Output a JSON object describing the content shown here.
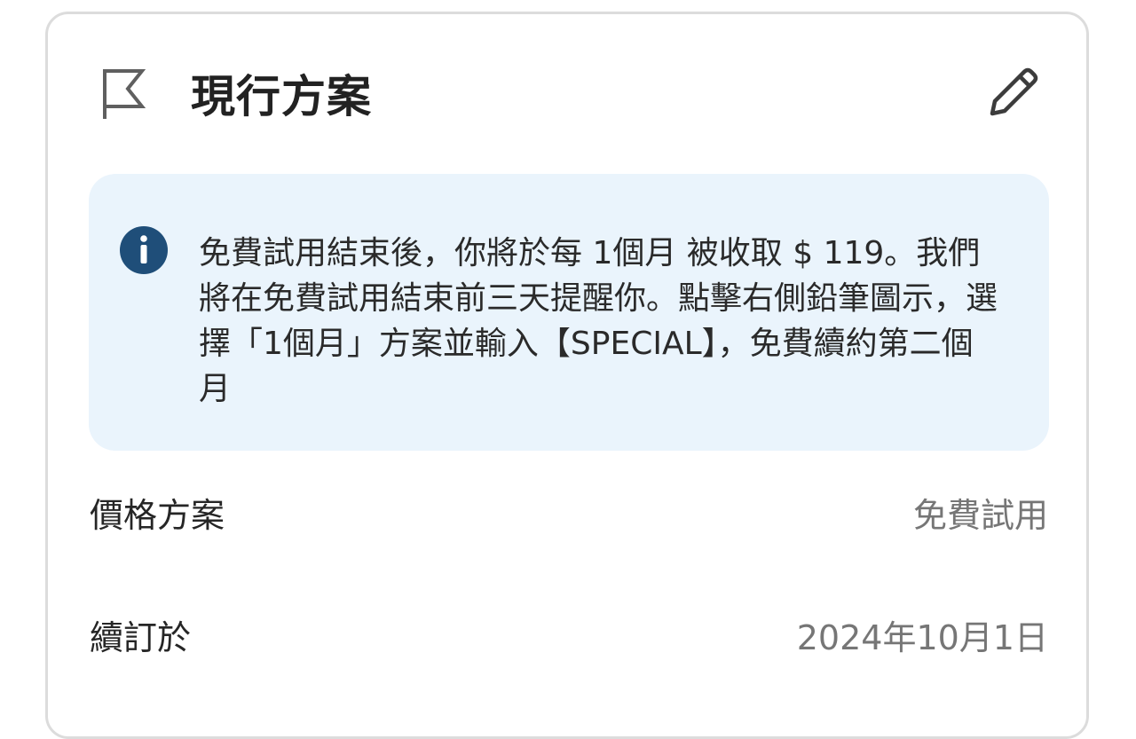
{
  "card": {
    "title": "現行方案",
    "icons": {
      "header": "flag-icon",
      "edit": "pencil-icon",
      "info": "info-icon"
    },
    "info": {
      "message": "免費試用結束後，你將於每 1個月 被收取 $ 119。我們將在免費試用結束前三天提醒你。點擊右側鉛筆圖示，選擇「1個月」方案並輸入【SPECIAL】，免費續約第二個月",
      "background_color": "#eaf4fc",
      "icon_color": "#1f4e79"
    },
    "details": [
      {
        "label": "價格方案",
        "value": "免費試用"
      },
      {
        "label": "續訂於",
        "value": "2024年10月1日"
      }
    ]
  }
}
